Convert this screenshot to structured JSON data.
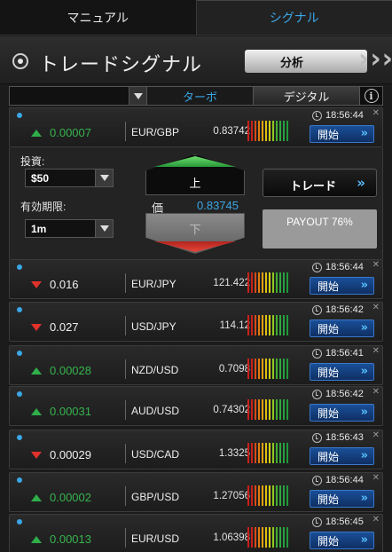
{
  "top_tabs": {
    "manual": "マニュアル",
    "signal": "シグナル"
  },
  "header": {
    "title": "トレードシグナル",
    "analysis_label": "分析"
  },
  "filter": {
    "turbo": "ターボ",
    "digital": "デジタル",
    "info": "i"
  },
  "colors": {
    "accent_blue": "#3aa7e8",
    "up_green": "#35b44e",
    "down_red": "#e0312b"
  },
  "rows": [
    {
      "direction": "up",
      "change": "0.00007",
      "pair": "EUR/GBP",
      "rate": "0.83742",
      "time": "18:56:44",
      "button": "開始"
    },
    {
      "direction": "down",
      "change": "0.016",
      "pair": "EUR/JPY",
      "rate": "121.422",
      "time": "18:56:44",
      "button": "開始"
    },
    {
      "direction": "down",
      "change": "0.027",
      "pair": "USD/JPY",
      "rate": "114.12",
      "time": "18:56:42",
      "button": "開始"
    },
    {
      "direction": "up",
      "change": "0.00028",
      "pair": "NZD/USD",
      "rate": "0.7098",
      "time": "18:56:41",
      "button": "開始"
    },
    {
      "direction": "up",
      "change": "0.00031",
      "pair": "AUD/USD",
      "rate": "0.74302",
      "time": "18:56:42",
      "button": "開始"
    },
    {
      "direction": "down",
      "change": "0.00029",
      "pair": "USD/CAD",
      "rate": "1.3325",
      "time": "18:56:43",
      "button": "開始"
    },
    {
      "direction": "up",
      "change": "0.00002",
      "pair": "GBP/USD",
      "rate": "1.27056",
      "time": "18:56:44",
      "button": "開始"
    },
    {
      "direction": "up",
      "change": "0.00013",
      "pair": "EUR/USD",
      "rate": "1.06398",
      "time": "18:56:45",
      "button": "開始"
    }
  ],
  "trade_panel": {
    "investment_label": "投資:",
    "investment_value": "$50",
    "expiry_label": "有効期限:",
    "expiry_value": "1m",
    "up_label": "上",
    "down_label": "下",
    "price_label": "価",
    "price_value": "0.83745",
    "trade_label": "トレード",
    "payout": "PAYOUT 76%"
  }
}
